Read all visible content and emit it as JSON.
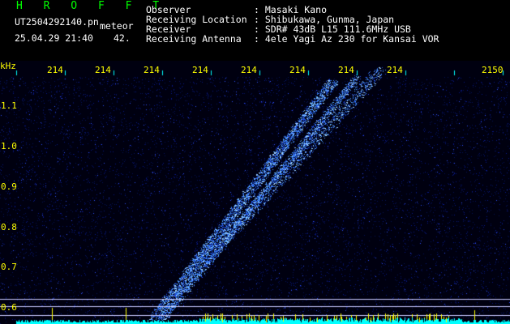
{
  "header": {
    "program": "H R O F F T",
    "filename": "UT2504292140.pn",
    "mode": "meteor",
    "date_time": "25.04.29 21:40",
    "count": "42.",
    "fields": [
      {
        "label": "Observer",
        "value": ": Masaki Kano"
      },
      {
        "label": "Receiving Location",
        "value": ": Shibukawa, Gunma, Japan"
      },
      {
        "label": "Receiver",
        "value": ": SDR# 43dB L15 111.6MHz USB"
      },
      {
        "label": "Receiving Antenna",
        "value": ": 4ele Yagi Az 230 for Kansai VOR"
      }
    ]
  },
  "plot": {
    "unit_label": "kHz",
    "x_ticks": [
      "214",
      "214",
      "214",
      "214",
      "214",
      "214",
      "214",
      "214",
      "2150"
    ],
    "y_ticks": [
      "1.1",
      "1.0",
      "0.9",
      "0.8",
      "0.7",
      "0.6"
    ],
    "colors": {
      "background": "#000010",
      "noise": "#1a2fd0",
      "echo": "#4fa0ff",
      "baseline": "#00ffff",
      "marker": "#ffff00",
      "hline": "#c8c8ff"
    }
  }
}
